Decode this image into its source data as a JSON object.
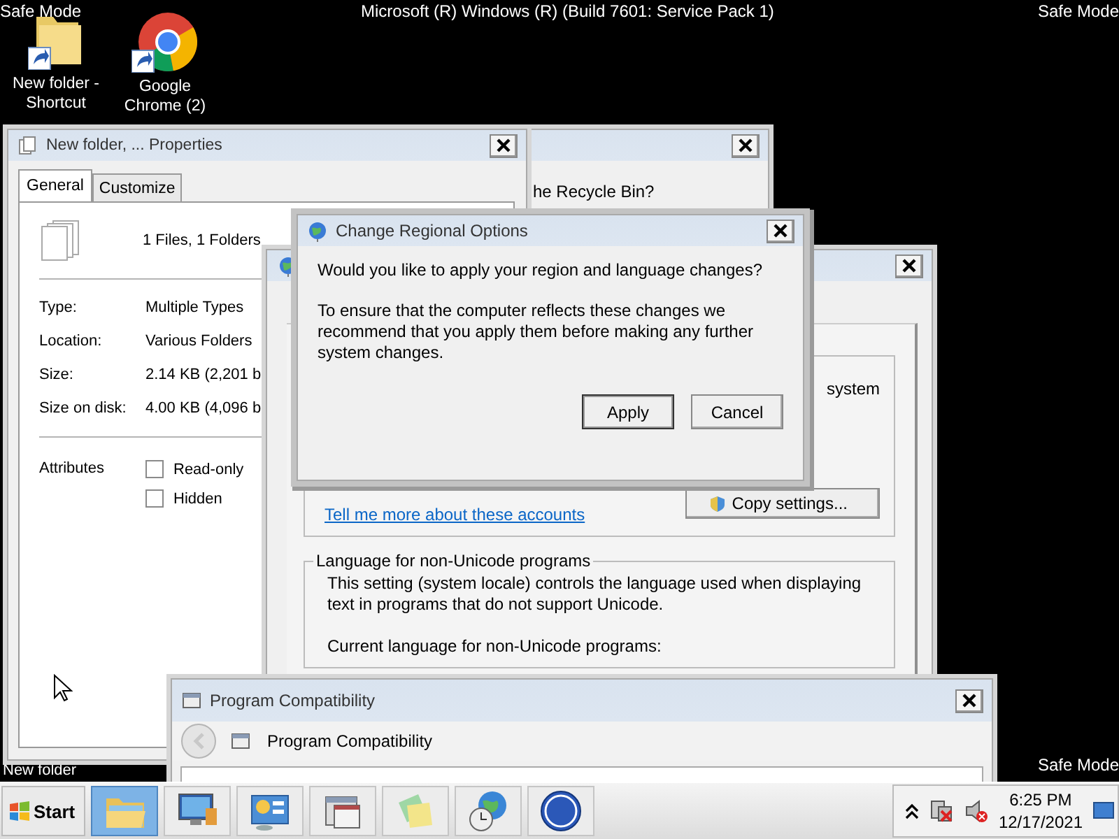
{
  "desktop": {
    "corner_labels": [
      "Safe Mode",
      "Safe Mode",
      "Safe Mode"
    ],
    "build": "Microsoft (R) Windows (R) (Build 7601: Service Pack 1)",
    "icons": [
      {
        "label": "New folder - Shortcut",
        "kind": "folder"
      },
      {
        "label": "Google Chrome (2)",
        "kind": "browser"
      }
    ],
    "hidden_icon_label": "New folder"
  },
  "recycle_window": {
    "text": "he Recycle Bin?"
  },
  "regional_window": {
    "system_text": "system",
    "copy_button": "Copy settings...",
    "link": "Tell me more about these accounts",
    "group": {
      "title": "Language for non-Unicode programs",
      "description": "This setting (system locale) controls the language used when displaying text in programs that do not support Unicode.",
      "current_label": "Current language for non-Unicode programs:"
    }
  },
  "properties_window": {
    "title": "New folder, ... Properties",
    "tabs": [
      {
        "label": "General",
        "selected": true
      },
      {
        "label": "Customize",
        "selected": false
      }
    ],
    "summary": "1 Files, 1 Folders",
    "fields": [
      {
        "label": "Type:",
        "value": "Multiple Types"
      },
      {
        "label": "Location:",
        "value": "Various Folders"
      },
      {
        "label": "Size:",
        "value": "2.14 KB (2,201 b"
      },
      {
        "label": "Size on disk:",
        "value": "4.00 KB (4,096 b"
      }
    ],
    "attributes_label": "Attributes",
    "attributes": [
      {
        "label": "Read-only",
        "checked": false
      },
      {
        "label": "Hidden",
        "checked": false
      }
    ]
  },
  "dialog": {
    "title": "Change Regional Options",
    "question": "Would you like to apply your region and language changes?",
    "message": "To ensure that the computer reflects these changes we recommend that you apply them before making any further system changes.",
    "buttons": [
      {
        "label": "Apply",
        "default": true
      },
      {
        "label": "Cancel",
        "default": false
      }
    ]
  },
  "compat_window": {
    "title": "Program Compatibility",
    "heading": "Program Compatibility"
  },
  "taskbar": {
    "start": "Start",
    "buttons": [
      {
        "kind": "explorer",
        "active": true
      },
      {
        "kind": "computer",
        "active": false
      },
      {
        "kind": "control-panel",
        "active": false
      },
      {
        "kind": "windows",
        "active": false
      },
      {
        "kind": "notes",
        "active": false
      },
      {
        "kind": "globe-clock",
        "active": false
      },
      {
        "kind": "help",
        "active": false
      }
    ],
    "clock": {
      "time": "6:25 PM",
      "date": "12/17/2021"
    }
  }
}
